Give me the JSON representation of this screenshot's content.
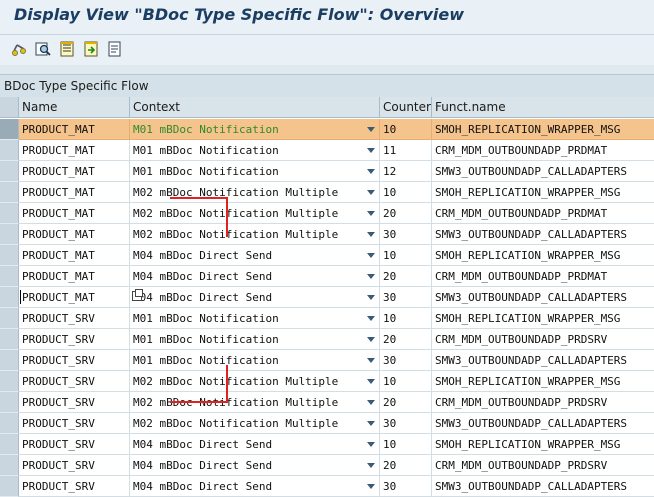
{
  "window": {
    "title": "Display View \"BDoc Type Specific Flow\": Overview"
  },
  "toolbar": {
    "buttons": [
      "glasses-icon",
      "find-icon",
      "list-icon",
      "export-icon",
      "print-icon"
    ]
  },
  "section": {
    "title": "BDoc Type Specific Flow"
  },
  "table": {
    "columns": [
      "Name",
      "Context",
      "Counter",
      "Funct.name"
    ],
    "rows": [
      {
        "name": "PRODUCT_MAT",
        "context": "M01 mBDoc Notification",
        "counter": "10",
        "func": "SMOH_REPLICATION_WRAPPER_MSG",
        "selected": true
      },
      {
        "name": "PRODUCT_MAT",
        "context": "M01 mBDoc Notification",
        "counter": "11",
        "func": "CRM_MDM_OUTBOUNDADP_PRDMAT"
      },
      {
        "name": "PRODUCT_MAT",
        "context": "M01 mBDoc Notification",
        "counter": "12",
        "func": "SMW3_OUTBOUNDADP_CALLADAPTERS"
      },
      {
        "name": "PRODUCT_MAT",
        "context": "M02 mBDoc Notification Multiple",
        "counter": "10",
        "func": "SMOH_REPLICATION_WRAPPER_MSG"
      },
      {
        "name": "PRODUCT_MAT",
        "context": "M02 mBDoc Notification Multiple",
        "counter": "20",
        "func": "CRM_MDM_OUTBOUNDADP_PRDMAT"
      },
      {
        "name": "PRODUCT_MAT",
        "context": "M02 mBDoc Notification Multiple",
        "counter": "30",
        "func": "SMW3_OUTBOUNDADP_CALLADAPTERS"
      },
      {
        "name": "PRODUCT_MAT",
        "context": "M04 mBDoc Direct Send",
        "counter": "10",
        "func": "SMOH_REPLICATION_WRAPPER_MSG"
      },
      {
        "name": "PRODUCT_MAT",
        "context": "M04 mBDoc Direct Send",
        "counter": "20",
        "func": "CRM_MDM_OUTBOUNDADP_PRDMAT"
      },
      {
        "name": "PRODUCT_MAT",
        "context": "M04 mBDoc Direct Send",
        "counter": "30",
        "func": "SMW3_OUTBOUNDADP_CALLADAPTERS"
      },
      {
        "name": "PRODUCT_SRV",
        "context": "M01 mBDoc Notification",
        "counter": "10",
        "func": "SMOH_REPLICATION_WRAPPER_MSG"
      },
      {
        "name": "PRODUCT_SRV",
        "context": "M01 mBDoc Notification",
        "counter": "20",
        "func": "CRM_MDM_OUTBOUNDADP_PRDSRV"
      },
      {
        "name": "PRODUCT_SRV",
        "context": "M01 mBDoc Notification",
        "counter": "30",
        "func": "SMW3_OUTBOUNDADP_CALLADAPTERS"
      },
      {
        "name": "PRODUCT_SRV",
        "context": "M02 mBDoc Notification Multiple",
        "counter": "10",
        "func": "SMOH_REPLICATION_WRAPPER_MSG"
      },
      {
        "name": "PRODUCT_SRV",
        "context": "M02 mBDoc Notification Multiple",
        "counter": "20",
        "func": "CRM_MDM_OUTBOUNDADP_PRDSRV"
      },
      {
        "name": "PRODUCT_SRV",
        "context": "M02 mBDoc Notification Multiple",
        "counter": "30",
        "func": "SMW3_OUTBOUNDADP_CALLADAPTERS"
      },
      {
        "name": "PRODUCT_SRV",
        "context": "M04 mBDoc Direct Send",
        "counter": "10",
        "func": "SMOH_REPLICATION_WRAPPER_MSG"
      },
      {
        "name": "PRODUCT_SRV",
        "context": "M04 mBDoc Direct Send",
        "counter": "20",
        "func": "CRM_MDM_OUTBOUNDADP_PRDSRV"
      },
      {
        "name": "PRODUCT_SRV",
        "context": "M04 mBDoc Direct Send",
        "counter": "30",
        "func": "SMW3_OUTBOUNDADP_CALLADAPTERS"
      }
    ]
  },
  "colors": {
    "title": "#1a3d61",
    "selected_row": "#f5c48d",
    "selected_context_text": "#2c8a2c",
    "annotation": "#e0231f"
  }
}
